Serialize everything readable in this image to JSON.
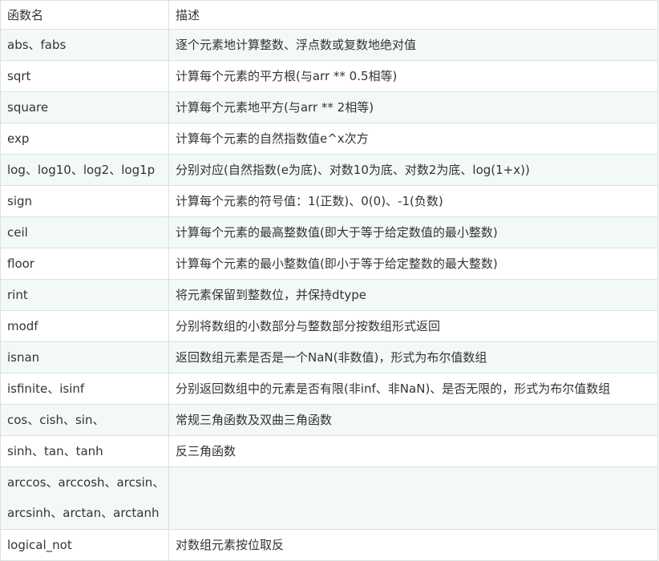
{
  "header": {
    "name": "函数名",
    "desc": "描述"
  },
  "rows": [
    {
      "name": "abs、fabs",
      "desc": "逐个元素地计算整数、浮点数或复数地绝对值"
    },
    {
      "name": "sqrt",
      "desc": "计算每个元素的平方根(与arr ** 0.5相等)"
    },
    {
      "name": "square",
      "desc": "计算每个元素地平方(与arr ** 2相等)"
    },
    {
      "name": "exp",
      "desc": "计算每个元素的自然指数值e^x次方"
    },
    {
      "name": "log、log10、log2、log1p",
      "desc": "分别对应(自然指数(e为底)、对数10为底、对数2为底、log(1+x))"
    },
    {
      "name": "sign",
      "desc": "计算每个元素的符号值：1(正数)、0(0)、-1(负数)"
    },
    {
      "name": "ceil",
      "desc": "计算每个元素的最高整数值(即大于等于给定数值的最小整数)"
    },
    {
      "name": "floor",
      "desc": "计算每个元素的最小整数值(即小于等于给定整数的最大整数)"
    },
    {
      "name": "rint",
      "desc": "将元素保留到整数位，并保持dtype"
    },
    {
      "name": "modf",
      "desc": "分别将数组的小数部分与整数部分按数组形式返回"
    },
    {
      "name": "isnan",
      "desc": "返回数组元素是否是一个NaN(非数值)，形式为布尔值数组"
    },
    {
      "name": "isfinite、isinf",
      "desc": "分别返回数组中的元素是否有限(非inf、非NaN)、是否无限的，形式为布尔值数组"
    },
    {
      "name": "cos、cish、sin、",
      "desc": "常规三角函数及双曲三角函数"
    },
    {
      "name": "sinh、tan、tanh",
      "desc": "反三角函数"
    }
  ],
  "tall_row": {
    "line1": "arccos、arccosh、arcsin、",
    "line2": "arcsinh、arctan、arctanh",
    "desc": ""
  },
  "last_row": {
    "name": "logical_not",
    "desc": "对数组元素按位取反"
  }
}
